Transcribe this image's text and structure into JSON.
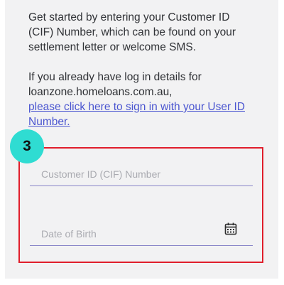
{
  "intro": {
    "line1": "Get started by entering your Customer ID",
    "line2": "(CIF) Number, which can be found on your",
    "line3": "settlement letter or welcome SMS.",
    "line4": "If you already have log in details for",
    "line5": "loanzone.homeloans.com.au,",
    "link_line1": "please click here to sign in with your User ID",
    "link_line2": "Number."
  },
  "callout": {
    "step_number": "3",
    "highlight_color": "#e01e2b",
    "badge_color": "#2fdcd2"
  },
  "form": {
    "cif_field": {
      "placeholder": "Customer ID (CIF) Number",
      "value": ""
    },
    "dob_field": {
      "placeholder": "Date of Birth",
      "value": "",
      "icon": "calendar-icon"
    }
  },
  "colors": {
    "link": "#4a55d0",
    "field_underline": "#8a86c8",
    "panel_background": "#f2f2f3"
  }
}
